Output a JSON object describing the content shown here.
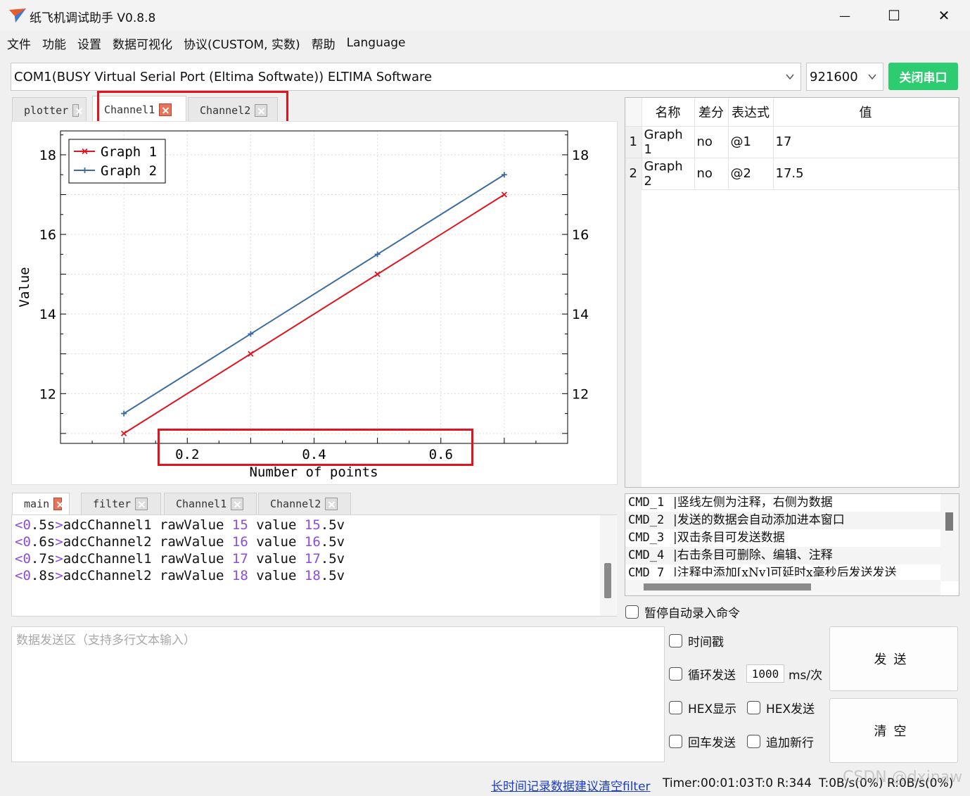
{
  "window": {
    "title": "纸飞机调试助手 V0.8.8",
    "minimize": "—",
    "maximize": "☐",
    "close": "✕"
  },
  "menu": [
    "文件",
    "功能",
    "设置",
    "数据可视化",
    "协议(CUSTOM, 实数)",
    "帮助",
    "Language"
  ],
  "port": {
    "selected": "COM1(BUSY  Virtual Serial Port (Eltima Softwate)) ELTIMA Software",
    "baud": "921600",
    "close_label": "关闭串口"
  },
  "plot_tabs": [
    {
      "label": "plotter",
      "active": false
    },
    {
      "label": "Channel1",
      "active": true
    },
    {
      "label": "Channel2",
      "active": false
    }
  ],
  "chart_data": {
    "type": "line",
    "xlabel": "Number of points",
    "ylabel": "Value",
    "xlim": [
      0,
      0.8
    ],
    "ylim": [
      10.75,
      18.6
    ],
    "xticks": [
      0.2,
      0.4,
      0.6
    ],
    "xtick_labels": [
      "0.2",
      "0.4",
      "0.6"
    ],
    "yticks": [
      12,
      14,
      16,
      18
    ],
    "ytick_labels": [
      "12",
      "14",
      "16",
      "18"
    ],
    "grid": true,
    "legend": "top-left",
    "series": [
      {
        "name": "Graph 1",
        "color": "#e0141e",
        "marker": "x",
        "x": [
          0.1,
          0.3,
          0.5,
          0.7
        ],
        "y": [
          11,
          13,
          15,
          17
        ]
      },
      {
        "name": "Graph 2",
        "color": "#3b6ba0",
        "marker": "+",
        "x": [
          0.1,
          0.3,
          0.5,
          0.7
        ],
        "y": [
          11.5,
          13.5,
          15.5,
          17.5
        ]
      }
    ]
  },
  "var_table": {
    "headers": [
      "名称",
      "差分",
      "表达式",
      "值"
    ],
    "rows": [
      {
        "num": "1",
        "name": "Graph 1",
        "diff": "no",
        "expr": "@1",
        "value": "17"
      },
      {
        "num": "2",
        "name": "Graph 2",
        "diff": "no",
        "expr": "@2",
        "value": "17.5"
      }
    ]
  },
  "log_tabs": [
    {
      "label": "main",
      "red": true
    },
    {
      "label": "filter",
      "red": false
    },
    {
      "label": "Channel1",
      "red": false
    },
    {
      "label": "Channel2",
      "red": false
    }
  ],
  "log_lines": [
    {
      "lt": "<",
      "t1": "0",
      "t2": ".5s",
      "gt": ">",
      "ch": "adcChannel1 rawValue ",
      "raw": "15",
      "mid": " value ",
      "v1": "15",
      "v2": ".5v"
    },
    {
      "lt": "<",
      "t1": "0",
      "t2": ".6s",
      "gt": ">",
      "ch": "adcChannel2 rawValue ",
      "raw": "16",
      "mid": " value ",
      "v1": "16",
      "v2": ".5v"
    },
    {
      "lt": "<",
      "t1": "0",
      "t2": ".7s",
      "gt": ">",
      "ch": "adcChannel1 rawValue ",
      "raw": "17",
      "mid": " value ",
      "v1": "17",
      "v2": ".5v"
    },
    {
      "lt": "<",
      "t1": "0",
      "t2": ".8s",
      "gt": ">",
      "ch": "adcChannel2 rawValue ",
      "raw": "18",
      "mid": " value ",
      "v1": "18",
      "v2": ".5v"
    }
  ],
  "cmds": [
    {
      "cmd": "CMD_1",
      "desc": "|竖线左侧为注释，右侧为数据"
    },
    {
      "cmd": "CMD_2",
      "desc": "|发送的数据会自动添加进本窗口"
    },
    {
      "cmd": "CMD_3",
      "desc": "|双击条目可发送数据"
    },
    {
      "cmd": "CMD_4",
      "desc": "|右击条目可删除、编辑、注释"
    },
    {
      "cmd": "CMD_7",
      "desc": "|注释中添加[xNy]可延时x毫秒后发送发送"
    }
  ],
  "pause_auto": "暂停自动录入命令",
  "send_area": {
    "placeholder": "数据发送区（支持多行文本输入）"
  },
  "options": {
    "timestamp": "时间戳",
    "loop_send": "循环发送",
    "loop_ms": "1000",
    "loop_unit": "ms/次",
    "hex_show": "HEX显示",
    "hex_send": "HEX发送",
    "enter_send": "回车发送",
    "append_newline": "追加新行"
  },
  "buttons": {
    "send": "发送",
    "clear": "清空"
  },
  "status": {
    "link": "长时间记录数据建议清空filter",
    "timer": "Timer:00:01:03",
    "counts": "T:0 R:344",
    "rates": "T:0B/s(0%) R:0B/s(0%)",
    "watermark": "CSDN @dxinaw"
  }
}
